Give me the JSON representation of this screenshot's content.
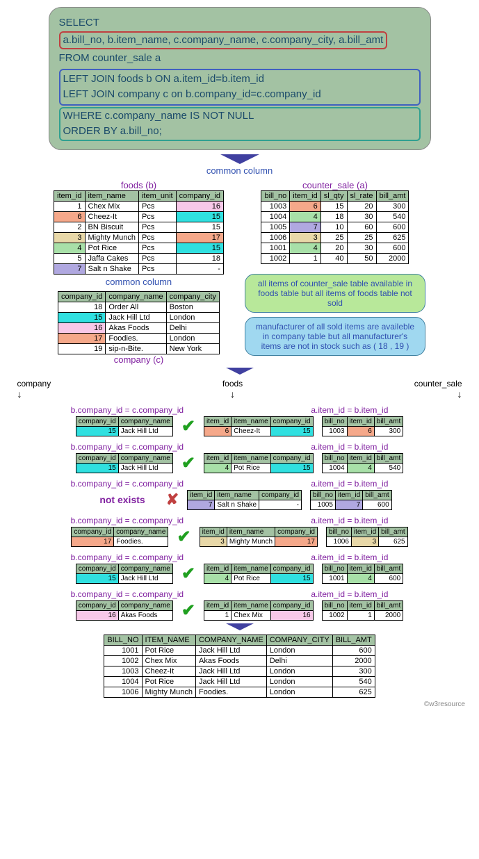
{
  "sql": {
    "select_pre": "SELECT ",
    "select_cols": "a.bill_no, b.item_name, c.company_name, c.company_city, a.bill_amt",
    "from": "FROM counter_sale a",
    "join1": "LEFT JOIN foods b ON a.item_id=b.item_id",
    "join2": "LEFT JOIN company c on b.company_id=c.company_id",
    "where": "WHERE c.company_name IS NOT NULL",
    "order": "ORDER BY a.bill_no;"
  },
  "labels": {
    "common_column": "common column",
    "foods_b": "foods (b)",
    "counter_sale_a": "counter_sale (a)",
    "company_c": "company (c)",
    "company": "company",
    "foods": "foods",
    "counter_sale": "counter_sale",
    "join_bc": "b.company_id = c.company_id",
    "join_ab": "a.item_id = b.item_id",
    "not_exists": "not exists",
    "credit": "©w3resource"
  },
  "notes": {
    "green": "all items of counter_sale table available in foods table but all items of foods table not sold",
    "blue": "manufacturer of all sold items are availeble in company table but all manufacturer's items are not in stock such as ( 18 , 19 )"
  },
  "foods": {
    "headers": [
      "item_id",
      "item_name",
      "item_unit",
      "company_id"
    ],
    "rows": [
      {
        "id": "1",
        "name": "Chex Mix",
        "unit": "Pcs",
        "cid": "16",
        "idc": "",
        "cidc": "c-pink"
      },
      {
        "id": "6",
        "name": "Cheez-It",
        "unit": "Pcs",
        "cid": "15",
        "idc": "c-salmon",
        "cidc": "c-cyan"
      },
      {
        "id": "2",
        "name": "BN Biscuit",
        "unit": "Pcs",
        "cid": "15",
        "idc": "",
        "cidc": ""
      },
      {
        "id": "3",
        "name": "Mighty Munch",
        "unit": "Pcs",
        "cid": "17",
        "idc": "c-tan",
        "cidc": "c-salmon"
      },
      {
        "id": "4",
        "name": "Pot Rice",
        "unit": "Pcs",
        "cid": "15",
        "idc": "c-green",
        "cidc": "c-cyan"
      },
      {
        "id": "5",
        "name": "Jaffa Cakes",
        "unit": "Pcs",
        "cid": "18",
        "idc": "",
        "cidc": ""
      },
      {
        "id": "7",
        "name": "Salt n Shake",
        "unit": "Pcs",
        "cid": "-",
        "idc": "c-lav",
        "cidc": ""
      }
    ]
  },
  "counter_sale": {
    "headers": [
      "bill_no",
      "item_id",
      "sl_qty",
      "sl_rate",
      "bill_amt"
    ],
    "rows": [
      {
        "bn": "1003",
        "iid": "6",
        "q": "15",
        "r": "20",
        "a": "300",
        "c": "c-salmon"
      },
      {
        "bn": "1004",
        "iid": "4",
        "q": "18",
        "r": "30",
        "a": "540",
        "c": "c-green"
      },
      {
        "bn": "1005",
        "iid": "7",
        "q": "10",
        "r": "60",
        "a": "600",
        "c": "c-lav"
      },
      {
        "bn": "1006",
        "iid": "3",
        "q": "25",
        "r": "25",
        "a": "625",
        "c": "c-tan"
      },
      {
        "bn": "1001",
        "iid": "4",
        "q": "20",
        "r": "30",
        "a": "600",
        "c": "c-green"
      },
      {
        "bn": "1002",
        "iid": "1",
        "q": "40",
        "r": "50",
        "a": "2000",
        "c": ""
      }
    ]
  },
  "company": {
    "headers": [
      "company_id",
      "company_name",
      "company_city"
    ],
    "rows": [
      {
        "id": "18",
        "name": "Order All",
        "city": "Boston",
        "c": ""
      },
      {
        "id": "15",
        "name": "Jack Hill Ltd",
        "city": "London",
        "c": "c-cyan"
      },
      {
        "id": "16",
        "name": "Akas Foods",
        "city": "Delhi",
        "c": "c-pink"
      },
      {
        "id": "17",
        "name": "Foodies.",
        "city": "London",
        "c": "c-salmon"
      },
      {
        "id": "19",
        "name": "sip-n-Bite.",
        "city": "New York",
        "c": ""
      }
    ]
  },
  "join_steps": [
    {
      "ok": true,
      "comp": {
        "id": "15",
        "name": "Jack Hill Ltd",
        "c": "c-cyan"
      },
      "food": {
        "id": "6",
        "name": "Cheez-It",
        "cid": "15",
        "idc": "c-salmon",
        "cidc": "c-cyan"
      },
      "cs": {
        "bn": "1003",
        "iid": "6",
        "a": "300",
        "c": "c-salmon"
      }
    },
    {
      "ok": true,
      "comp": {
        "id": "15",
        "name": "Jack Hill Ltd",
        "c": "c-cyan"
      },
      "food": {
        "id": "4",
        "name": "Pot Rice",
        "cid": "15",
        "idc": "c-green",
        "cidc": "c-cyan"
      },
      "cs": {
        "bn": "1004",
        "iid": "4",
        "a": "540",
        "c": "c-green"
      }
    },
    {
      "ok": false,
      "comp": null,
      "food": {
        "id": "7",
        "name": "Salt n Shake",
        "cid": "-",
        "idc": "c-lav",
        "cidc": ""
      },
      "cs": {
        "bn": "1005",
        "iid": "7",
        "a": "600",
        "c": "c-lav"
      }
    },
    {
      "ok": true,
      "comp": {
        "id": "17",
        "name": "Foodies.",
        "c": "c-salmon"
      },
      "food": {
        "id": "3",
        "name": "Mighty Munch",
        "cid": "17",
        "idc": "c-tan",
        "cidc": "c-salmon"
      },
      "cs": {
        "bn": "1006",
        "iid": "3",
        "a": "625",
        "c": "c-tan"
      }
    },
    {
      "ok": true,
      "comp": {
        "id": "15",
        "name": "Jack Hill Ltd",
        "c": "c-cyan"
      },
      "food": {
        "id": "4",
        "name": "Pot Rice",
        "cid": "15",
        "idc": "c-green",
        "cidc": "c-cyan"
      },
      "cs": {
        "bn": "1001",
        "iid": "4",
        "a": "600",
        "c": "c-green"
      }
    },
    {
      "ok": true,
      "comp": {
        "id": "16",
        "name": "Akas Foods",
        "c": "c-pink"
      },
      "food": {
        "id": "1",
        "name": "Chex Mix",
        "cid": "16",
        "idc": "",
        "cidc": "c-pink"
      },
      "cs": {
        "bn": "1002",
        "iid": "1",
        "a": "2000",
        "c": ""
      }
    }
  ],
  "result": {
    "headers": [
      "BILL_NO",
      "ITEM_NAME",
      "COMPANY_NAME",
      "COMPANY_CITY",
      "BILL_AMT"
    ],
    "rows": [
      {
        "bn": "1001",
        "in": "Pot Rice",
        "cn": "Jack Hill Ltd",
        "cc": "London",
        "a": "600"
      },
      {
        "bn": "1002",
        "in": "Chex Mix",
        "cn": "Akas Foods",
        "cc": "Delhi",
        "a": "2000"
      },
      {
        "bn": "1003",
        "in": "Cheez-It",
        "cn": "Jack Hill Ltd",
        "cc": "London",
        "a": "300"
      },
      {
        "bn": "1004",
        "in": "Pot Rice",
        "cn": "Jack Hill Ltd",
        "cc": "London",
        "a": "540"
      },
      {
        "bn": "1006",
        "in": "Mighty Munch",
        "cn": "Foodies.",
        "cc": "London",
        "a": "625"
      }
    ]
  }
}
